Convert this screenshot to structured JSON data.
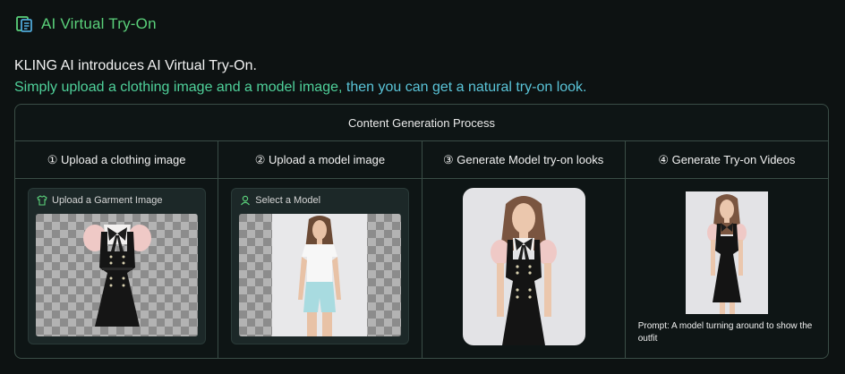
{
  "header": {
    "title": "AI Virtual Try-On",
    "icon": "document-icon"
  },
  "intro": {
    "line1": "KLING AI introduces AI Virtual Try-On.",
    "line2_a": "Simply upload a clothing image and a model image,",
    "line2_b": " then you can get a natural try-on look."
  },
  "table": {
    "heading": "Content Generation Process",
    "steps": [
      {
        "label": "① Upload a clothing image"
      },
      {
        "label": "② Upload a model image"
      },
      {
        "label": "③ Generate Model try-on looks"
      },
      {
        "label": "④ Generate Try-on Videos"
      }
    ],
    "garment_card": {
      "label": "Upload a Garment Image",
      "icon": "shirt-icon"
    },
    "model_card": {
      "label": "Select a Model",
      "icon": "user-icon"
    },
    "video": {
      "prompt": "Prompt: A model turning around to show the outfit"
    }
  },
  "colors": {
    "accent_green": "#5ad07a",
    "accent_teal": "#4fd19a",
    "border": "#3a4d46",
    "background": "#0d1212"
  }
}
